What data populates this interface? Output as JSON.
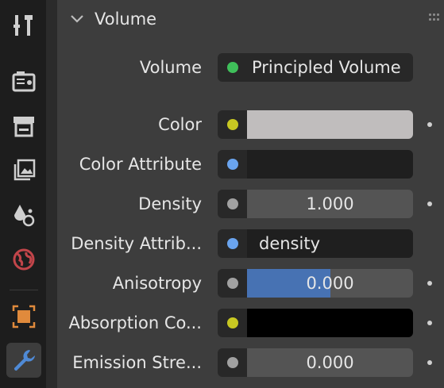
{
  "colors": {
    "socket_shader": "#3fbf5a",
    "socket_color": "#c8c822",
    "socket_vector": "#6aa4ee",
    "socket_float": "#a1a1a1",
    "color_swatch": "#c0bdbd",
    "absorption_swatch": "#000000",
    "slider_fill": "#4772b3"
  },
  "sidebar": {
    "tabs": [
      {
        "name": "tool-icon",
        "active": false
      },
      {
        "name": "render-icon",
        "active": false
      },
      {
        "name": "output-icon",
        "active": false
      },
      {
        "name": "view-layer-icon",
        "active": false
      },
      {
        "name": "scene-icon",
        "active": false
      },
      {
        "name": "world-icon",
        "active": false
      },
      {
        "name": "object-icon",
        "active": false
      },
      {
        "name": "modifier-wrench-icon",
        "active": true
      }
    ]
  },
  "panel": {
    "title": "Volume",
    "volume_label": "Volume",
    "shader_value": "Principled Volume",
    "rows": [
      {
        "label": "Color",
        "socket": "color",
        "kind": "swatch"
      },
      {
        "label": "Color Attribute",
        "socket": "vector",
        "kind": "text",
        "value": ""
      },
      {
        "label": "Density",
        "socket": "float",
        "kind": "num",
        "value": "1.000"
      },
      {
        "label": "Density Attrib...",
        "socket": "vector",
        "kind": "text",
        "value": "density"
      },
      {
        "label": "Anisotropy",
        "socket": "float",
        "kind": "slider",
        "value": "0.000",
        "fill_fraction": 0.5
      },
      {
        "label": "Absorption Co...",
        "socket": "color",
        "kind": "swatch"
      },
      {
        "label": "Emission Stre...",
        "socket": "float",
        "kind": "num",
        "value": "0.000"
      }
    ]
  }
}
